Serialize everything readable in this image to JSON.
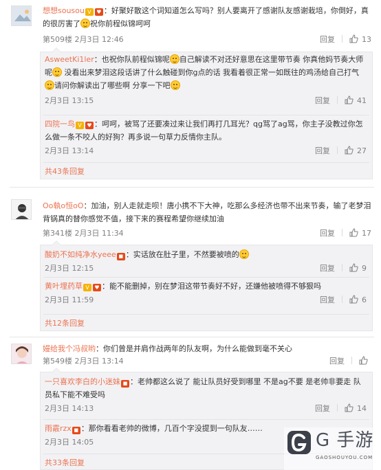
{
  "threads": [
    {
      "user": "想想sousou",
      "text_a": "：好聚好散这个词知道怎么写吗？别人要离开了感谢队友感谢栽培，你倒好，真的很厉害了",
      "text_b": "祝你前程似锦呵呵",
      "floor_time": "第509楼 2月3日 12:46",
      "reply_label": "回复",
      "likes": "13",
      "replies": [
        {
          "user": "AsweetKi1ler",
          "text_a": "：也祝你队前程似锦呢",
          "text_b": "自己解读不对还好意思在这里带节奏 你真他妈节奏大师呢",
          "text_c": " 没看出来梦泪这段话讲了什么触碰到你g点的话 我看着很正常一如既往的鸡汤给自己打气",
          "text_d": "请问你解读出了哪些啊 分享一下吧",
          "time": "2月3日 13:15",
          "reply_label": "回复",
          "likes": "41"
        },
        {
          "user": "四院一鸟",
          "text_a": "：呵呵，被骂了还要凑过来让我们再打几耳光？qg骂了ag骂，你主子没教过你怎么做一条不咬人的好狗？再多说一句草力反情你主队。",
          "time": "2月3日 13:14",
          "reply_label": "回复",
          "likes": "27"
        }
      ],
      "more": "共43条回复"
    },
    {
      "user": "Oo執o恒oO",
      "text_a": "：加油，别人走就走呗！唐小携不下大神，吃那么多经济也带不出来节奏，输了老梦泪背锅真的替你感觉不值，接下来的赛程希望你继续加油",
      "floor_time": "第341楼 2月3日 11:34",
      "reply_label": "回复",
      "likes": "17",
      "replies": [
        {
          "user": "酸奶不如纯净水yeee",
          "text_a": "：实话放在肚子里，不然要被喷的",
          "time": "2月3日 12:15",
          "reply_label": "回复",
          "likes": "9"
        },
        {
          "user": "黄叶埋药草",
          "text_a": "：能不能删掉，别在梦泪这带节奏好不好，还嫌他被喷得不够狠吗",
          "time": "2月3日 11:59",
          "reply_label": "回复",
          "likes": "6"
        }
      ],
      "more": "共12条回复"
    },
    {
      "user": "嫚给我个冯叔哟",
      "text_a": "：你们曾是并肩作战两年的队友啊，为什么能做到毫不关心",
      "floor_time": "第549楼 2月3日 13:14",
      "reply_label": "回复",
      "likes": "",
      "replies": [
        {
          "user": "一只喜欢李白的小迷妹",
          "text_a": "：老帅都这么说了 能让队员好受到哪里 不是ag不要 是老帅非要走 队员私下能不难受吗",
          "time": "2月3日 14:13",
          "reply_label": "回复",
          "likes": "14"
        },
        {
          "user": "雨霰rzx",
          "text_a": "：那你看看老帅的微博，几百个字没提到一句队友……",
          "time": "2月3日 14:05",
          "reply_label": "回复",
          "likes": ""
        }
      ],
      "more": "共33条回复"
    }
  ],
  "watermark": {
    "title": "G 手游",
    "sub": "GAOSHOUYOU.COM"
  },
  "colors": {
    "username": "#eb7350",
    "meta": "#808080",
    "reply_bg": "#f2f2f5"
  },
  "icons": [
    "vip-badge-icon",
    "heart-badge-icon",
    "red-badge-icon",
    "smile-emoji-icon",
    "thumbs-up-icon",
    "avatar-icon",
    "gaoshouyou-logo-icon"
  ]
}
